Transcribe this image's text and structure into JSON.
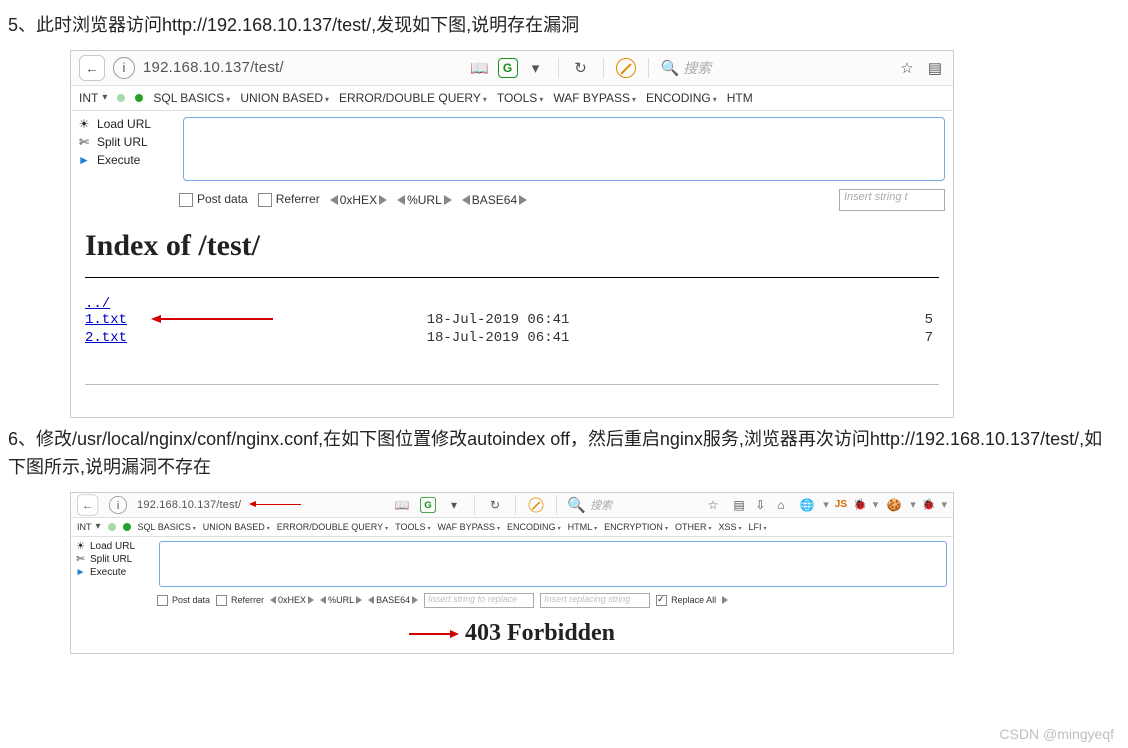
{
  "step5": {
    "text": "5、此时浏览器访问http://192.168.10.137/test/,发现如下图,说明存在漏洞"
  },
  "step6": {
    "text": "6、修改/usr/local/nginx/conf/nginx.conf,在如下图位置修改autoindex off，然后重启nginx服务,浏览器再次访问http://192.168.10.137/test/,如下图所示,说明漏洞不存在"
  },
  "browser1": {
    "url": "192.168.10.137/test/",
    "searchPlaceholder": "搜索",
    "menu": {
      "int": "INT",
      "items": [
        "SQL BASICS",
        "UNION BASED",
        "ERROR/DOUBLE QUERY",
        "TOOLS",
        "WAF BYPASS",
        "ENCODING",
        "HTM"
      ]
    },
    "tools": {
      "load": "Load URL",
      "split": "Split URL",
      "exec": "Execute"
    },
    "opts": {
      "post": "Post data",
      "ref": "Referrer",
      "hex": "0xHEX",
      "url": "%URL",
      "b64": "BASE64",
      "ins": "Insert string t"
    }
  },
  "listing": {
    "heading": "Index of /test/",
    "parent": "../",
    "rows": [
      {
        "name": "1.txt",
        "date": "18-Jul-2019 06:41",
        "size": "5"
      },
      {
        "name": "2.txt",
        "date": "18-Jul-2019 06:41",
        "size": "7"
      }
    ]
  },
  "browser2": {
    "url": "192.168.10.137/test/",
    "searchPlaceholder": "搜索",
    "menu": {
      "int": "INT",
      "items": [
        "SQL BASICS",
        "UNION BASED",
        "ERROR/DOUBLE QUERY",
        "TOOLS",
        "WAF BYPASS",
        "ENCODING",
        "HTML",
        "ENCRYPTION",
        "OTHER",
        "XSS",
        "LFI"
      ]
    },
    "tools": {
      "load": "Load URL",
      "split": "Split URL",
      "exec": "Execute"
    },
    "opts": {
      "post": "Post data",
      "ref": "Referrer",
      "hex": "0xHEX",
      "url": "%URL",
      "b64": "BASE64",
      "ins1": "Insert string to replace",
      "ins2": "Insert replacing string",
      "rep": "Replace All"
    }
  },
  "forbidden": "403 Forbidden",
  "watermark": "CSDN @mingyeqf"
}
